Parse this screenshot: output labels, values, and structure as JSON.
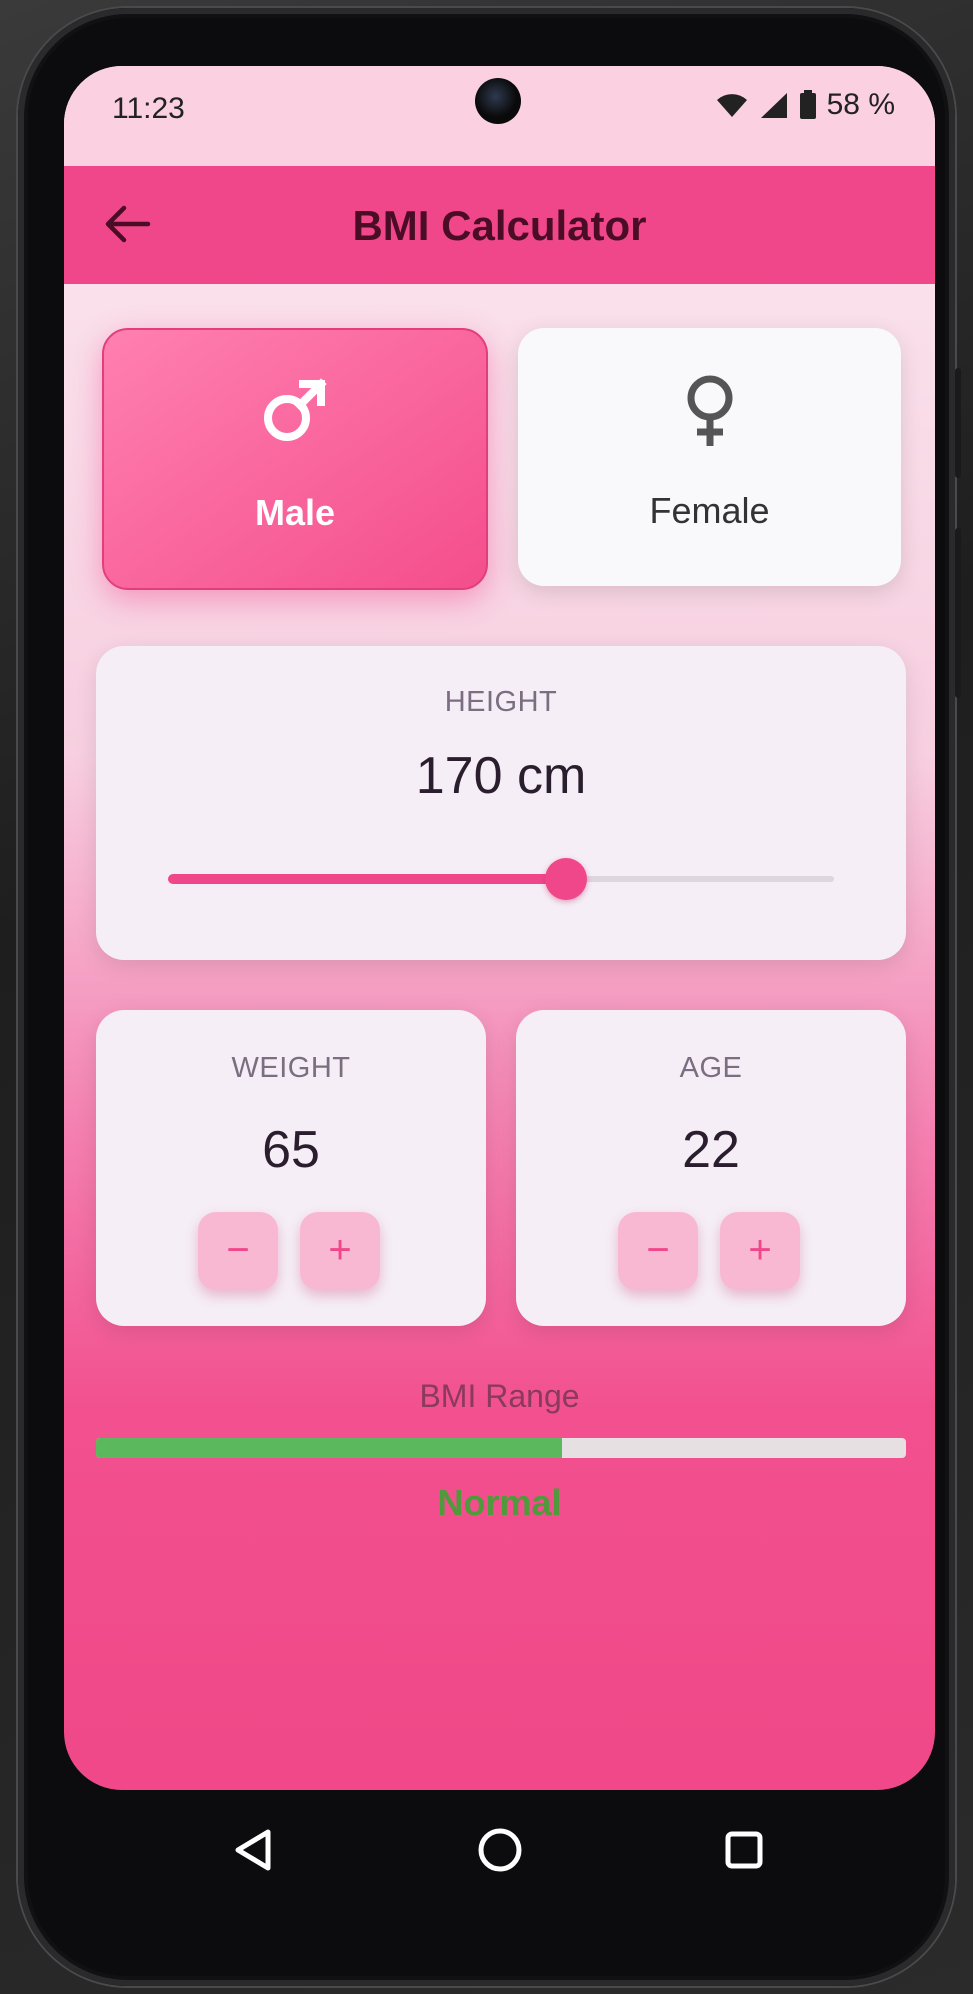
{
  "status_bar": {
    "time": "11:23",
    "battery": "58 %"
  },
  "app_bar": {
    "title": "BMI Calculator"
  },
  "gender": {
    "male_label": "Male",
    "female_label": "Female",
    "selected": "male",
    "male_icon": "male-symbol-icon",
    "female_icon": "female-symbol-icon"
  },
  "height": {
    "label": "HEIGHT",
    "display": "170 cm",
    "slider_fraction": 0.597
  },
  "weight": {
    "label": "WEIGHT",
    "value": "65",
    "minus": "−",
    "plus": "+"
  },
  "age": {
    "label": "AGE",
    "value": "22",
    "minus": "−",
    "plus": "+"
  },
  "bmi": {
    "label": "BMI Range",
    "status": "Normal",
    "fill_fraction": 0.575
  },
  "colors": {
    "accent": "#f0478a",
    "normal_green": "#5cb85c",
    "title_text": "#4a0d25"
  },
  "nav_icons": [
    "back-triangle-icon",
    "home-circle-icon",
    "recents-square-icon"
  ]
}
